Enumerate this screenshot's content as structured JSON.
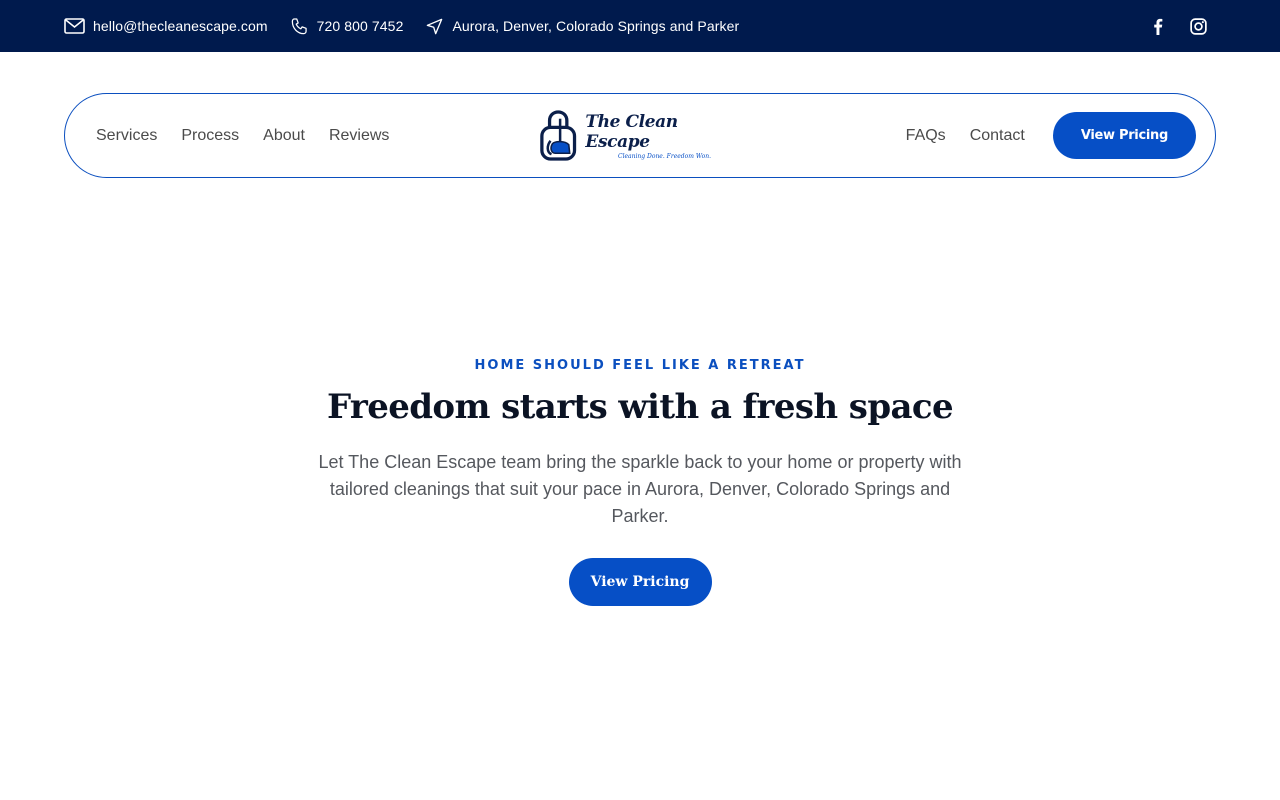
{
  "topbar": {
    "email": "hello@thecleanescape.com",
    "phone": "720 800 7452",
    "locations": "Aurora, Denver, Colorado Springs and Parker",
    "icons": [
      "mail-icon",
      "phone-icon",
      "location-arrow-icon",
      "facebook-icon",
      "instagram-icon"
    ],
    "background": "#001a4d"
  },
  "nav": {
    "left_links": [
      "Services",
      "Process",
      "About",
      "Reviews"
    ],
    "right_links": [
      "FAQs",
      "Contact"
    ],
    "cta_label": "View Pricing",
    "logo": {
      "brand": "The Clean Escape",
      "tagline": "Cleaning Done. Freedom Won."
    }
  },
  "hero": {
    "eyebrow": "HOME SHOULD FEEL LIKE A RETREAT",
    "headline": "Freedom starts with a fresh space",
    "lede": "Let The Clean Escape team bring the sparkle back to your home or property with tailored cleanings that suit your pace in Aurora, Denver, Colorado Springs and Parker.",
    "cta_label": "View Pricing"
  },
  "colors": {
    "accent": "#064fc6",
    "dark_navy": "#001a4d",
    "headline": "#0b1324"
  }
}
